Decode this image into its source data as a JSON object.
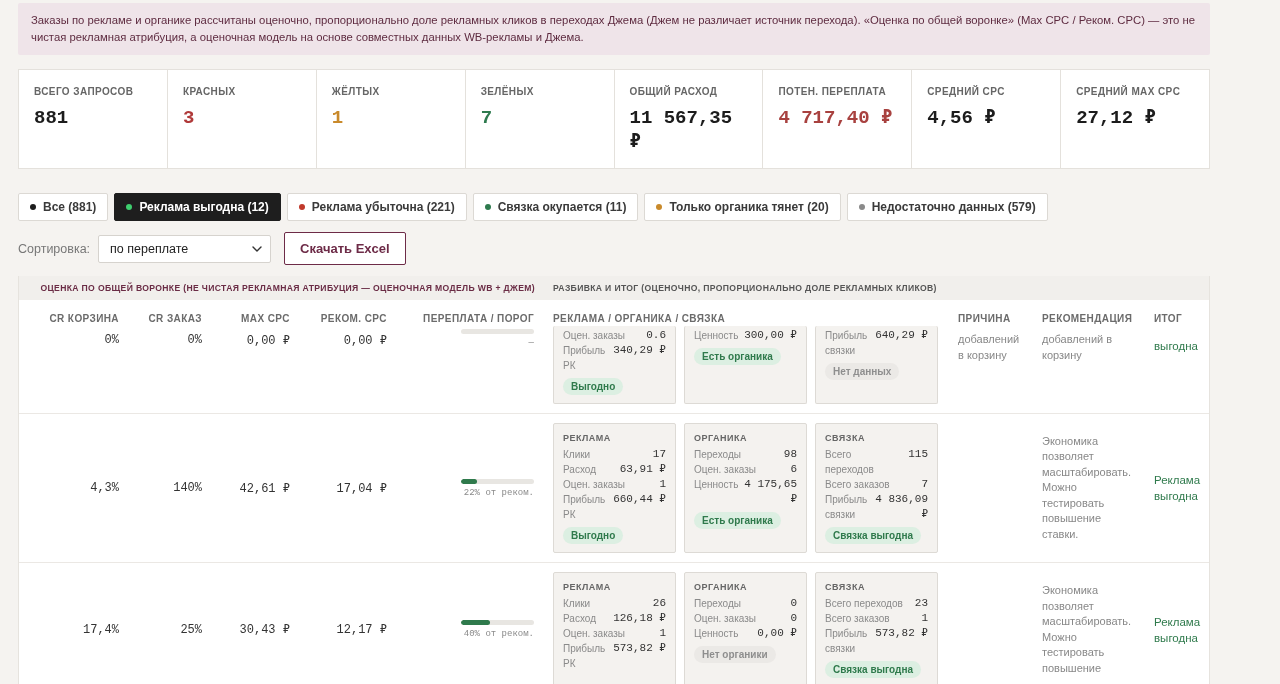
{
  "notice": "Заказы по рекламе и органике рассчитаны оценочно, пропорционально доле рекламных кликов в переходах Джема (Джем не различает источник перехода). «Оценка по общей воронке» (Max CPC / Реком. CPC) — это не чистая рекламная атрибуция, а оценочная модель на основе совместных данных WB-рекламы и Джема.",
  "stats": [
    {
      "label": "ВСЕГО ЗАПРОСОВ",
      "value": "881",
      "color": "#1c1c1c"
    },
    {
      "label": "КРАСНЫХ",
      "value": "3",
      "color": "#b03a3a"
    },
    {
      "label": "ЖЁЛТЫХ",
      "value": "1",
      "color": "#c98a2b"
    },
    {
      "label": "ЗЕЛЁНЫХ",
      "value": "7",
      "color": "#2e7a4e"
    },
    {
      "label": "ОБЩИЙ РАСХОД",
      "value": "11 567,35 ₽",
      "color": "#1c1c1c"
    },
    {
      "label": "ПОТЕН. ПЕРЕПЛАТА",
      "value": "4 717,40 ₽",
      "color": "#a8413f"
    },
    {
      "label": "СРЕДНИЙ CPC",
      "value": "4,56 ₽",
      "color": "#1c1c1c"
    },
    {
      "label": "СРЕДНИЙ MAX CPC",
      "value": "27,12 ₽",
      "color": "#1c1c1c"
    }
  ],
  "filters": [
    {
      "label": "Все (881)",
      "color": "#1c1c1c",
      "selected": false
    },
    {
      "label": "Реклама выгодна (12)",
      "color": "#3ecf6e",
      "selected": true
    },
    {
      "label": "Реклама убыточна (221)",
      "color": "#c0392b",
      "selected": false
    },
    {
      "label": "Связка окупается (11)",
      "color": "#2e7a4e",
      "selected": false
    },
    {
      "label": "Только органика тянет (20)",
      "color": "#c98a2b",
      "selected": false
    },
    {
      "label": "Недостаточно данных (579)",
      "color": "#8a8a8a",
      "selected": false
    }
  ],
  "sort": {
    "label": "Сортировка:",
    "value": "по переплате"
  },
  "export_button": "Скачать Excel",
  "table": {
    "groups": [
      {
        "label": "ОЦЕНКА ПО ОБЩЕЙ ВОРОНКЕ (НЕ ЧИСТАЯ РЕКЛАМНАЯ АТРИБУЦИЯ — ОЦЕНОЧНАЯ МОДЕЛЬ WB + ДЖЕМ)",
        "accent": true
      },
      {
        "label": "РАЗБИВКА И ИТОГ (ОЦЕНОЧНО, ПРОПОРЦИОНАЛЬНО ДОЛЕ РЕКЛАМНЫХ КЛИКОВ)",
        "accent": false
      }
    ],
    "columns": [
      "CR КОРЗИНА",
      "CR ЗАКАЗ",
      "MAX CPC",
      "РЕКОМ. CPC",
      "ПЕРЕПЛАТА / ПОРОГ",
      "РЕКЛАМА / ОРГАНИКА / СВЯЗКА",
      "ПРИЧИНА",
      "РЕКОМЕНДАЦИЯ",
      "ИТОГ"
    ],
    "rows": [
      {
        "cut_top": true,
        "cr_cart": "0%",
        "cr_order": "0%",
        "max_cpc": "0,00 ₽",
        "rec_cpc": "0,00 ₽",
        "overpay": {
          "reading": "—"
        },
        "breakdown": [
          {
            "lines": [
              {
                "label": "Оцен. заказы",
                "value": "0.6"
              },
              {
                "label": "Прибыль РК",
                "value": "340,29 ₽"
              }
            ],
            "badge": {
              "text": "Выгодно",
              "kind": "positive"
            }
          },
          {
            "lines": [
              {
                "label": "Ценность",
                "value": "300,00 ₽"
              }
            ],
            "badge": {
              "text": "Есть органика",
              "kind": "positive"
            }
          },
          {
            "lines": [
              {
                "label": "Прибыль связки",
                "value": "640,29 ₽"
              }
            ],
            "badge": {
              "text": "Нет данных",
              "kind": "neutral"
            }
          }
        ],
        "reason": "добавлений в корзину",
        "recommendation": "добавлений в корзину",
        "result": {
          "text": "выгодна",
          "kind": "positive"
        }
      },
      {
        "cut_top": false,
        "cr_cart": "4,3%",
        "cr_order": "140%",
        "max_cpc": "42,61 ₽",
        "rec_cpc": "17,04 ₽",
        "overpay": {
          "level": 0.22,
          "reading": "22% от реком."
        },
        "breakdown": [
          {
            "title": "РЕКЛАМА",
            "lines": [
              {
                "label": "Клики",
                "value": "17"
              },
              {
                "label": "Расход",
                "value": "63,91 ₽"
              },
              {
                "label": "Оцен. заказы",
                "value": "1"
              },
              {
                "label": "Прибыль РК",
                "value": "660,44 ₽"
              }
            ],
            "badge": {
              "text": "Выгодно",
              "kind": "positive"
            }
          },
          {
            "title": "ОРГАНИКА",
            "lines": [
              {
                "label": "Переходы",
                "value": "98"
              },
              {
                "label": "Оцен. заказы",
                "value": "6"
              },
              {
                "label": "Ценность",
                "value": "4 175,65 ₽"
              }
            ],
            "badge": {
              "text": "Есть органика",
              "kind": "positive"
            }
          },
          {
            "title": "СВЯЗКА",
            "lines": [
              {
                "label": "Всего переходов",
                "value": "115"
              },
              {
                "label": "Всего заказов",
                "value": "7"
              },
              {
                "label": "Прибыль связки",
                "value": "4 836,09 ₽"
              }
            ],
            "badge": {
              "text": "Связка выгодна",
              "kind": "positive"
            }
          }
        ],
        "recommendation": "Экономика позволяет масштабировать. Можно тестировать повышение ставки.",
        "result": {
          "text": "Реклама выгодна",
          "kind": "positive"
        }
      },
      {
        "cut_top": false,
        "cr_cart": "17,4%",
        "cr_order": "25%",
        "max_cpc": "30,43 ₽",
        "rec_cpc": "12,17 ₽",
        "overpay": {
          "level": 0.4,
          "reading": "40% от реком."
        },
        "breakdown": [
          {
            "title": "РЕКЛАМА",
            "lines": [
              {
                "label": "Клики",
                "value": "26"
              },
              {
                "label": "Расход",
                "value": "126,18 ₽"
              },
              {
                "label": "Оцен. заказы",
                "value": "1"
              },
              {
                "label": "Прибыль РК",
                "value": "573,82 ₽"
              }
            ]
          },
          {
            "title": "ОРГАНИКА",
            "lines": [
              {
                "label": "Переходы",
                "value": "0"
              },
              {
                "label": "Оцен. заказы",
                "value": "0"
              },
              {
                "label": "Ценность",
                "value": "0,00 ₽"
              }
            ],
            "badge": {
              "text": "Нет органики",
              "kind": "neutral"
            }
          },
          {
            "title": "СВЯЗКА",
            "lines": [
              {
                "label": "Всего переходов",
                "value": "23"
              },
              {
                "label": "Всего заказов",
                "value": "1"
              },
              {
                "label": "Прибыль связки",
                "value": "573,82 ₽"
              }
            ],
            "badge": {
              "text": "Связка выгодна",
              "kind": "positive"
            }
          }
        ],
        "recommendation": "Экономика позволяет масштабировать. Можно тестировать повышение",
        "result": {
          "text": "Реклама выгодна",
          "kind": "positive"
        }
      }
    ]
  }
}
